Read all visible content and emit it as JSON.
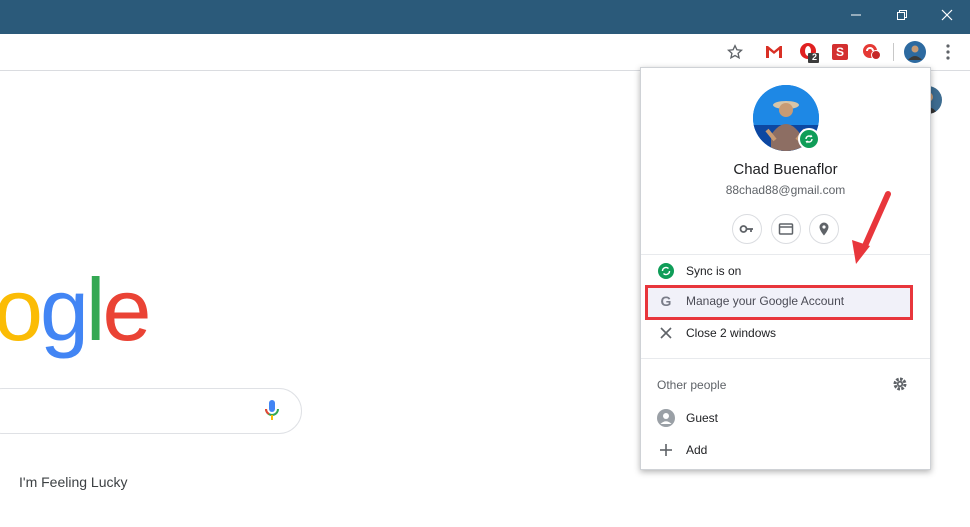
{
  "window": {
    "minimize_icon": "minimize-icon",
    "restore_icon": "restore-icon",
    "close_icon": "close-icon"
  },
  "toolbar": {
    "bookmark_icon": "star-icon",
    "extensions": [
      {
        "name": "gmail-icon",
        "color": "#d93025"
      },
      {
        "name": "opera-icon",
        "color": "#e02020",
        "badge": "2"
      },
      {
        "name": "s-extension-icon",
        "color": "#d32f2f",
        "letter": "S"
      },
      {
        "name": "red-extension-icon",
        "color": "#e53935"
      }
    ],
    "profile_icon": "profile-avatar-icon",
    "menu_icon": "kebab-menu-icon"
  },
  "page": {
    "logo_letters": [
      "o",
      "g",
      "l",
      "e"
    ],
    "logo_colors": [
      "#fbbc05",
      "#4285f4",
      "#34a853",
      "#ea4335"
    ],
    "lucky_label": "I'm Feeling Lucky"
  },
  "profile_menu": {
    "name": "Chad Buenaflor",
    "email": "88chad88@gmail.com",
    "quick_actions": [
      "key-icon",
      "card-icon",
      "location-pin-icon"
    ],
    "sync_label": "Sync is on",
    "manage_label": "Manage your Google Account",
    "close_label": "Close 2 windows",
    "other_people_label": "Other people",
    "guest_label": "Guest",
    "add_label": "Add"
  },
  "colors": {
    "titlebar": "#2b5a7a",
    "sync_green": "#0f9d58",
    "highlight_red": "#e8363c"
  }
}
